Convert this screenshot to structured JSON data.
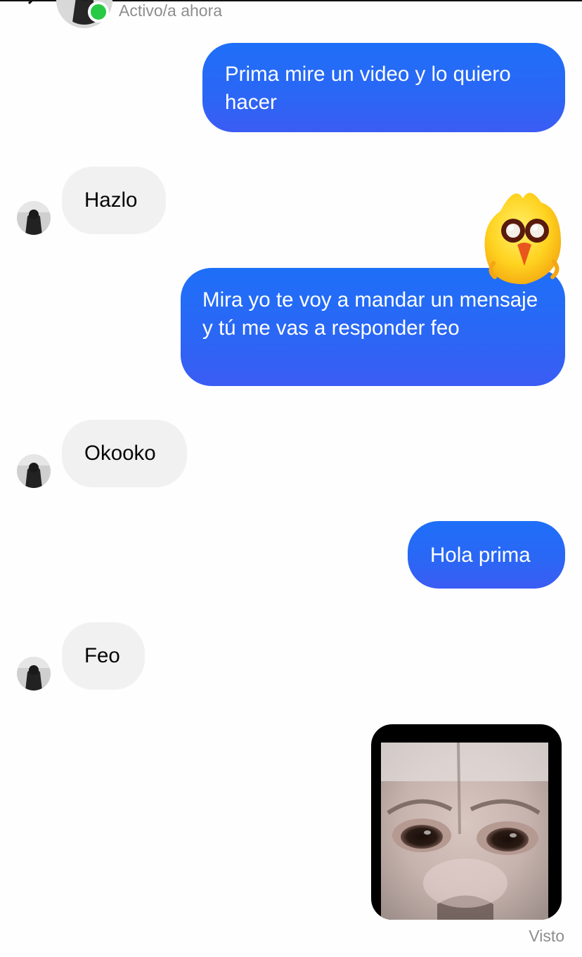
{
  "header": {
    "status": "Activo/a ahora",
    "online_color": "#27c945",
    "back_icon": "chevron-left-icon"
  },
  "messages": [
    {
      "from": "me",
      "text": "Prima mire un video y lo quiero hacer"
    },
    {
      "from": "contact",
      "text": "Hazlo"
    },
    {
      "from": "me",
      "text": "Mira yo te voy a mandar un mensaje y tú me vas a responder feo",
      "reaction": "excited-chick-sticker"
    },
    {
      "from": "contact",
      "text": "Okooko"
    },
    {
      "from": "me",
      "text": "Hola prima"
    },
    {
      "from": "contact",
      "text": "Feo"
    },
    {
      "from": "me",
      "type": "image",
      "image": "monkey-face-photo"
    }
  ],
  "footer": {
    "seen_label": "Visto"
  },
  "colors": {
    "sent_bubble": "#2a67f5",
    "received_bubble": "#f1f1f1",
    "meta_text": "#8e8e8e"
  }
}
